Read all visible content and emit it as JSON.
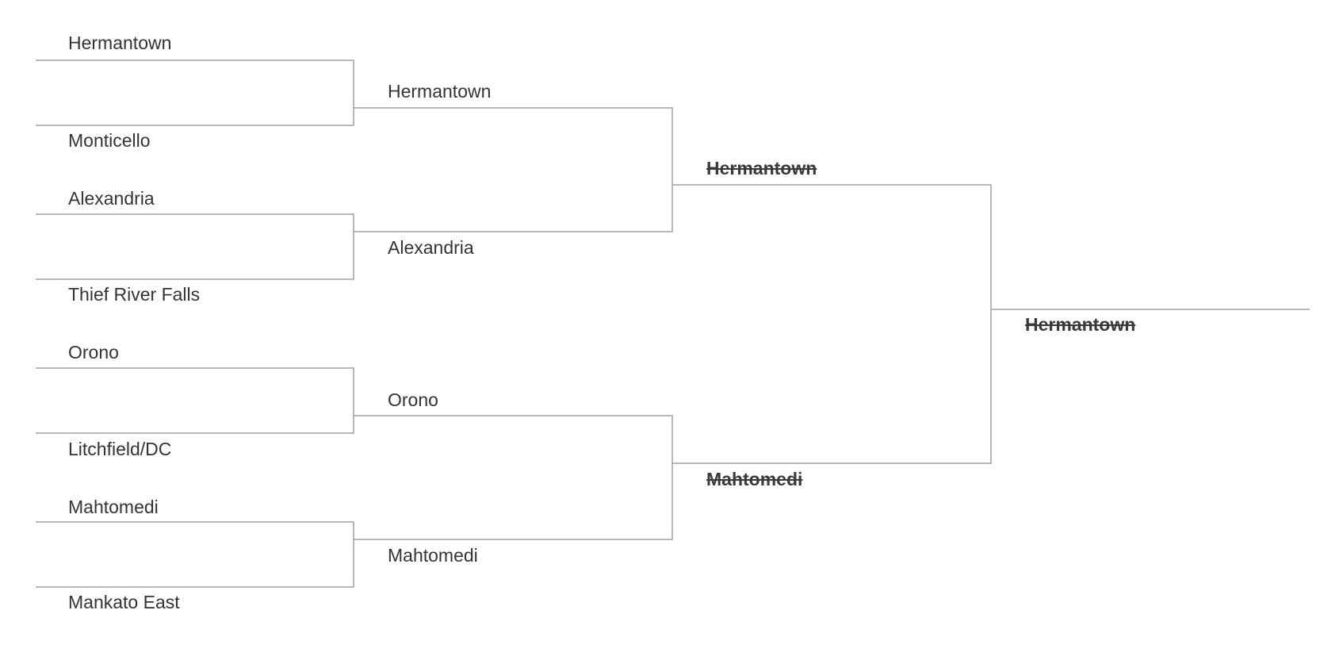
{
  "bracket": {
    "line_color": "#a0a0a0",
    "text_color": "#333333",
    "round1": [
      {
        "top": "Hermantown",
        "bottom": "Monticello"
      },
      {
        "top": "Alexandria",
        "bottom": "Thief River Falls"
      },
      {
        "top": "Orono",
        "bottom": "Litchfield/DC"
      },
      {
        "top": "Mahtomedi",
        "bottom": "Mankato East"
      }
    ],
    "round2": [
      {
        "top": "Hermantown",
        "bottom": "Alexandria"
      },
      {
        "top": "Orono",
        "bottom": "Mahtomedi"
      }
    ],
    "round3": [
      {
        "top": "Hermantown",
        "bottom": "Mahtomedi",
        "struck": true
      }
    ],
    "final": {
      "team": "Hermantown",
      "struck": true
    }
  }
}
